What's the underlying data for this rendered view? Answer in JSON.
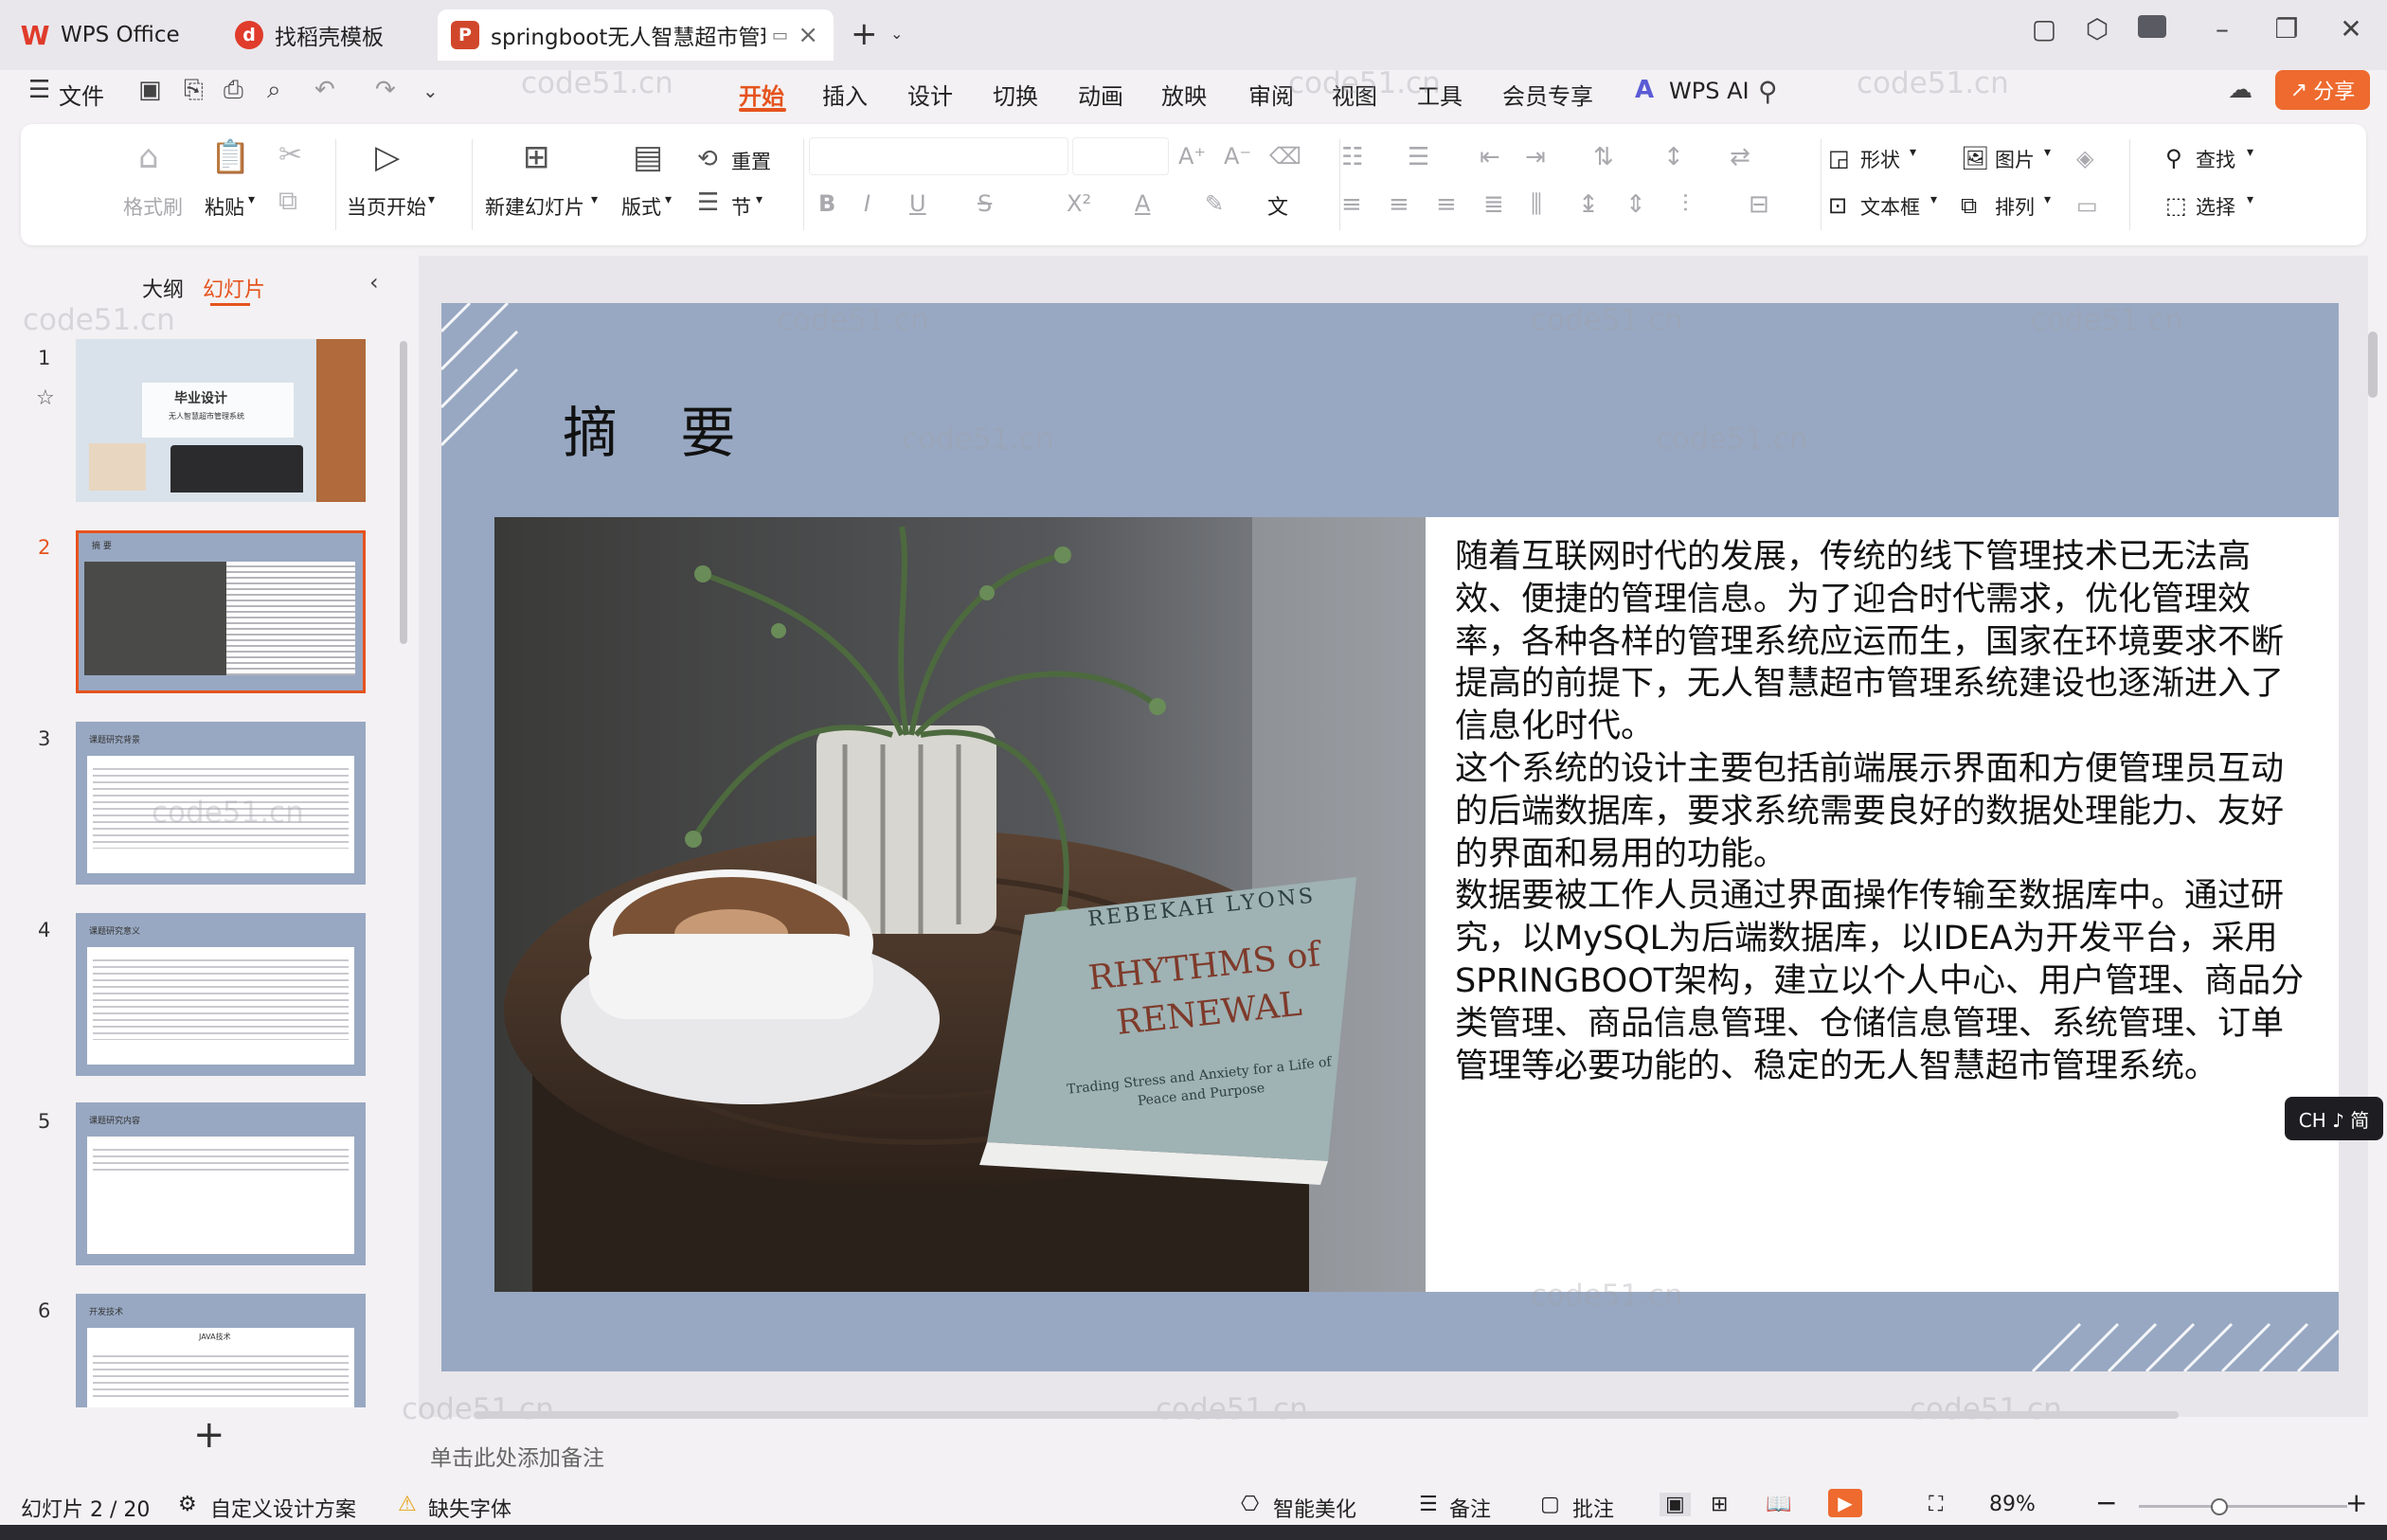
{
  "titlebar": {
    "tabs": [
      {
        "label": "WPS Office",
        "logo": "W",
        "color": "#e03b2b"
      },
      {
        "label": "找稻壳模板",
        "logo": "d",
        "color": "#e03b2b"
      },
      {
        "label": "springboot无人智慧超市管理",
        "logo": "P",
        "color": "#d1472b"
      }
    ],
    "new_tab": "+"
  },
  "menu": {
    "file": "文件",
    "items": [
      "开始",
      "插入",
      "设计",
      "切换",
      "动画",
      "放映",
      "审阅",
      "视图",
      "工具",
      "会员专享"
    ],
    "active": "开始",
    "wps_ai": "WPS AI",
    "share": "分享"
  },
  "ribbon": {
    "format_painter": "格式刷",
    "paste": "粘贴",
    "start_from_current": "当页开始",
    "new_slide": "新建幻灯片",
    "layout": "版式",
    "reset": "重置",
    "section": "节",
    "shape": "形状",
    "picture": "图片",
    "find": "查找",
    "textbox": "文本框",
    "arrange": "排列",
    "select": "选择",
    "bold": "B",
    "italic": "I",
    "underline": "U",
    "strike": "S",
    "superscript": "X²",
    "font_color": "A"
  },
  "left_panel": {
    "tab_outline": "大纲",
    "tab_slides": "幻灯片",
    "add_slide": "+",
    "slides": [
      {
        "num": "1",
        "title": "毕业设计",
        "subtitle": "无人智慧超市管理系统"
      },
      {
        "num": "2",
        "title": "摘 要"
      },
      {
        "num": "3",
        "title": "课题研究背景"
      },
      {
        "num": "4",
        "title": "课题研究意义"
      },
      {
        "num": "5",
        "title": "课题研究内容"
      },
      {
        "num": "6",
        "title": "开发技术",
        "subtitle": "JAVA技术"
      }
    ]
  },
  "slide": {
    "title": "摘 要",
    "book_title": "RHYTHMS of RENEWAL",
    "book_author": "REBEKAH LYONS",
    "book_sub": "Trading Stress and Anxiety for a Life of Peace and Purpose",
    "paragraphs": [
      "随着互联网时代的发展，传统的线下管理技术已无法高效、便捷的管理信息。为了迎合时代需求，优化管理效率，各种各样的管理系统应运而生，国家在环境要求不断提高的前提下，无人智慧超市管理系统建设也逐渐进入了信息化时代。",
      "这个系统的设计主要包括前端展示界面和方便管理员互动的后端数据库，要求系统需要良好的数据处理能力、友好的界面和易用的功能。",
      "数据要被工作人员通过界面操作传输至数据库中。通过研究，以MySQL为后端数据库，以IDEA为开发平台，采用SPRINGBOOT架构，建立以个人中心、用户管理、商品分类管理、商品信息管理、仓储信息管理、系统管理、订单管理等必要功能的、稳定的无人智慧超市管理系统。"
    ]
  },
  "watermark": "code51.cn",
  "notes_placeholder": "单击此处添加备注",
  "status": {
    "slide_counter": "幻灯片 2 / 20",
    "custom_design": "自定义设计方案",
    "missing_font": "缺失字体",
    "smart_beautify": "智能美化",
    "notes": "备注",
    "comments": "批注",
    "zoom": "89%"
  },
  "ime": "CH ♪ 简"
}
